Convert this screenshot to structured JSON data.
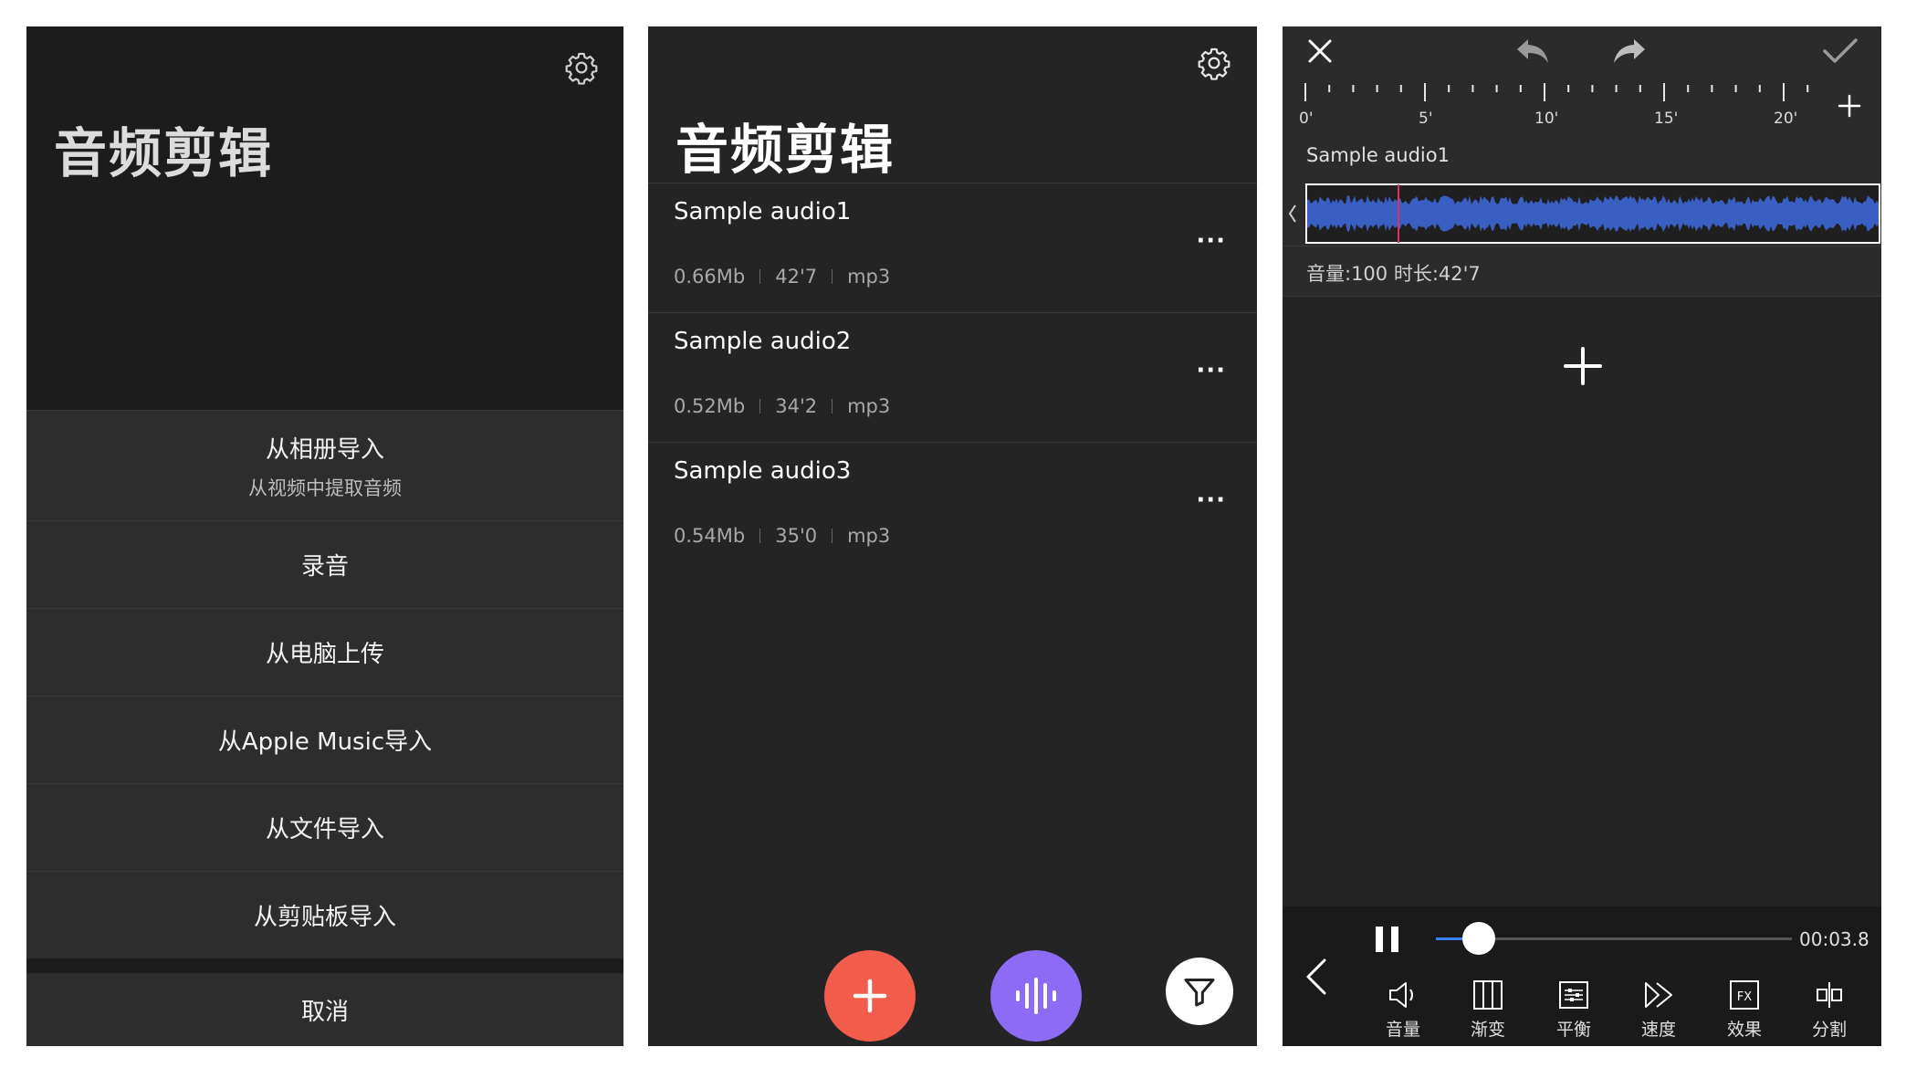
{
  "panel1": {
    "title": "音频剪辑",
    "menu": [
      {
        "label": "从相册导入",
        "sub": "从视频中提取音频"
      },
      {
        "label": "录音"
      },
      {
        "label": "从电脑上传"
      },
      {
        "label": "从Apple Music导入"
      },
      {
        "label": "从文件导入"
      },
      {
        "label": "从剪贴板导入"
      }
    ],
    "cancel": "取消"
  },
  "panel2": {
    "title": "音频剪辑",
    "items": [
      {
        "name": "Sample audio1",
        "size": "0.66Mb",
        "duration": "42'7",
        "format": "mp3"
      },
      {
        "name": "Sample audio2",
        "size": "0.52Mb",
        "duration": "34'2",
        "format": "mp3"
      },
      {
        "name": "Sample audio3",
        "size": "0.54Mb",
        "duration": "35'0",
        "format": "mp3"
      }
    ],
    "more": "···",
    "colors": {
      "add": "#f15d4a",
      "record": "#8e6bf5",
      "filter": "#ffffff"
    }
  },
  "panel3": {
    "ruler": [
      "0'",
      "5'",
      "10'",
      "15'",
      "20'"
    ],
    "track_name": "Sample audio1",
    "info": "音量:100 时长:42'7",
    "time": "00:03.8",
    "playback_progress": 0.12,
    "tools": [
      {
        "label": "音量",
        "icon": "volume-icon"
      },
      {
        "label": "渐变",
        "icon": "fade-icon"
      },
      {
        "label": "平衡",
        "icon": "balance-icon"
      },
      {
        "label": "速度",
        "icon": "speed-icon"
      },
      {
        "label": "效果",
        "icon": "fx-icon"
      },
      {
        "label": "分割",
        "icon": "split-icon"
      }
    ],
    "fx_glyph": "FX",
    "colors": {
      "waveform": "#3a5fc2",
      "playhead": "#e0315f",
      "slider": "#3b82f6"
    }
  }
}
